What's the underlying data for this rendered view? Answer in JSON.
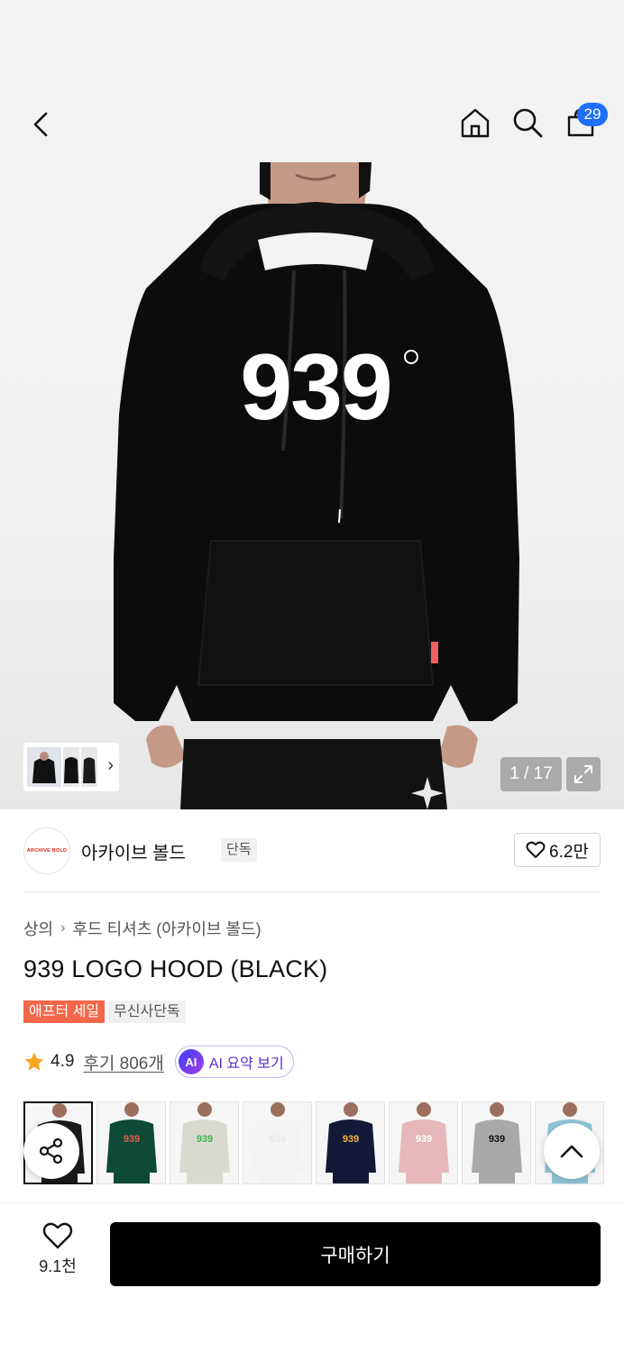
{
  "header": {
    "cart_count": "29",
    "icons": [
      "back-icon",
      "home-icon",
      "search-icon",
      "shopping-bag-icon"
    ]
  },
  "gallery": {
    "counter": "1 / 17",
    "print_text": "939"
  },
  "brand": {
    "logo_text": "ARCHIVE BOLD",
    "name": "아카이브 볼드",
    "tag": "단독",
    "likes": "6.2만"
  },
  "breadcrumb": {
    "items": [
      "상의",
      "후드 티셔츠 (아카이브 볼드)"
    ]
  },
  "product": {
    "title": "939 LOGO HOOD (BLACK)",
    "tags": [
      "애프터 세일",
      "무신사단독"
    ],
    "rating": "4.9",
    "reviews": "후기 806개",
    "ai_badge": "AI",
    "ai_summary": "AI 요약 보기"
  },
  "colorways": [
    {
      "name": "black",
      "color": "#1a1a1a",
      "print": "#ffffff"
    },
    {
      "name": "green",
      "color": "#0f4a36",
      "print": "#e8594a"
    },
    {
      "name": "oatmeal",
      "color": "#d9d9cf",
      "print": "#3fb54f"
    },
    {
      "name": "white",
      "color": "#f4f4f6",
      "print": "#e6e6e6"
    },
    {
      "name": "navy",
      "color": "#14193a",
      "print": "#f2b53a"
    },
    {
      "name": "pink",
      "color": "#e6b8bb",
      "print": "#ffffff"
    },
    {
      "name": "grey",
      "color": "#a9a9a9",
      "print": "#111111"
    },
    {
      "name": "sky",
      "color": "#8fc5d6",
      "print": "#ffffff"
    }
  ],
  "bottom": {
    "wish_count": "9.1천",
    "buy_label": "구매하기"
  }
}
